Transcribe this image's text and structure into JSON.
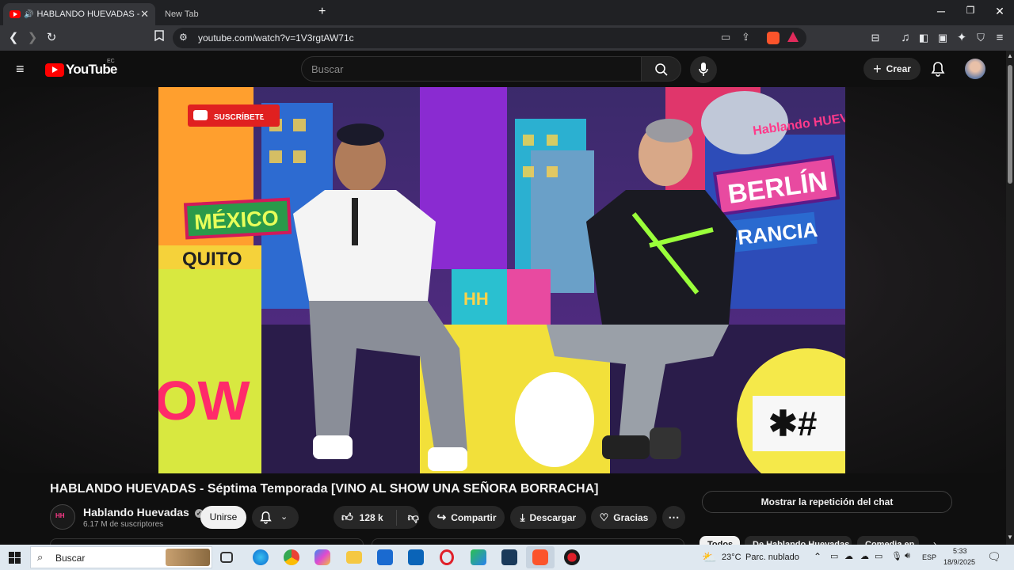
{
  "browser": {
    "tabs": [
      {
        "title": "HABLANDO HUEVADAS - Sé",
        "active": true
      },
      {
        "title": "New Tab",
        "active": false
      }
    ],
    "new_tab_symbol": "+",
    "url": "youtube.com/watch?v=1V3rgtAW71c",
    "icons": [
      "back-icon",
      "forward-icon",
      "reload-icon",
      "bookmark-icon",
      "site-info-icon",
      "cast-icon",
      "share-icon",
      "brave-shield-icon",
      "rewards-icon",
      "tab-search-icon",
      "media-icon",
      "sidebar-icon",
      "wallet-icon",
      "leo-icon",
      "vpn-icon",
      "menu-icon"
    ]
  },
  "youtube": {
    "logo_text": "YouTube",
    "country_code": "EC",
    "search_placeholder": "Buscar",
    "create_label": "Crear"
  },
  "video": {
    "overlay_subscribe": "SUSCRÍBETE",
    "sign_mexico": "MÉXICO",
    "sign_quito": "QUITO",
    "sign_berlin": "BERLÍN",
    "sign_francia": "FRANCIA",
    "sign_show_logo": "Hablando HUEVADAS",
    "sign_wow": "OW",
    "sign_hh": "HH"
  },
  "meta": {
    "title": "HABLANDO HUEVADAS - Séptima Temporada [VINO AL SHOW UNA SEÑORA BORRACHA]",
    "channel_name": "Hablando Huevadas",
    "subscribers": "6.17 M de suscriptores",
    "join_label": "Unirse",
    "likes": "128 k",
    "share_label": "Compartir",
    "download_label": "Descargar",
    "thanks_label": "Gracias",
    "chat_replay_label": "Mostrar la repetición del chat",
    "chips": [
      "Todos",
      "De Hablando Huevadas",
      "Comedia en"
    ]
  },
  "taskbar": {
    "search_placeholder": "Buscar",
    "weather_temp": "23°C",
    "weather_desc": "Parc. nublado",
    "lang": "ESP",
    "time": "5:33",
    "date": "18/9/2025"
  },
  "colors": {
    "yt_red": "#ff0000",
    "bg": "#0f0f0f",
    "pill_bg": "#272727",
    "taskbar_bg": "#dfe8f0"
  }
}
